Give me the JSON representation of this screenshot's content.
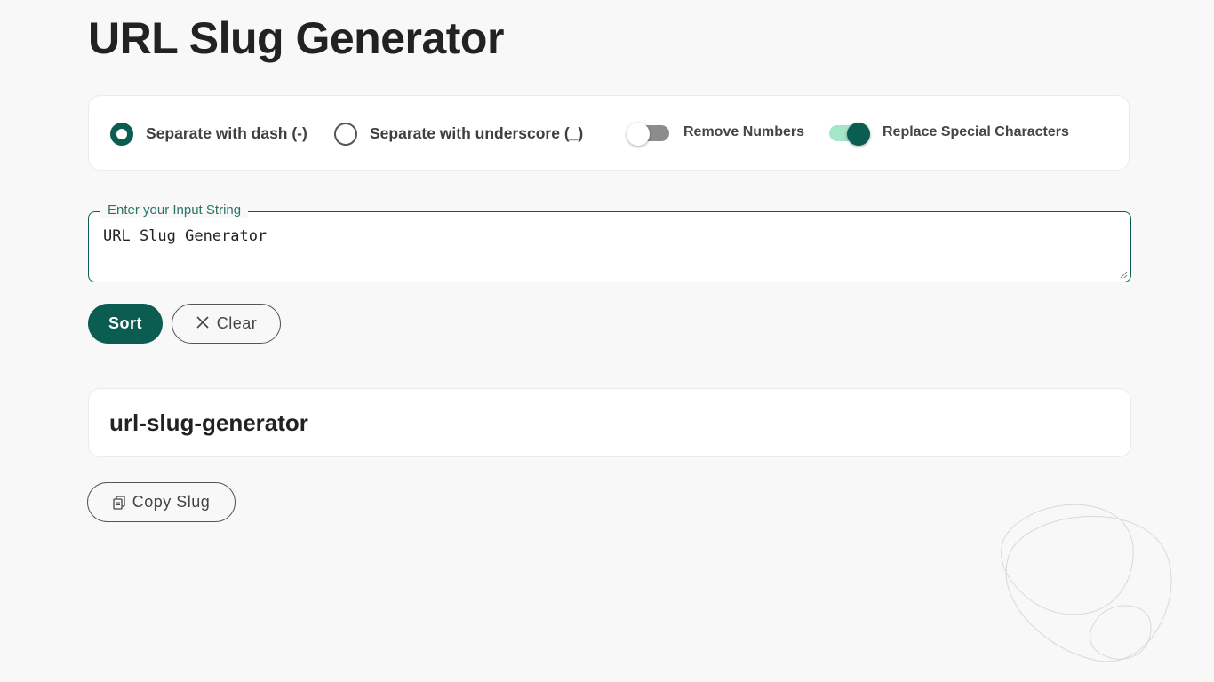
{
  "page": {
    "title": "URL Slug Generator"
  },
  "options": {
    "separator_dash_label": "Separate with dash (-)",
    "separator_underscore_label": "Separate with underscore (_)",
    "selected_separator": "dash",
    "remove_numbers_label": "Remove Numbers",
    "remove_numbers_enabled": false,
    "replace_special_label": "Replace Special Characters",
    "replace_special_enabled": true
  },
  "input": {
    "legend": "Enter your Input String",
    "value": "URL Slug Generator"
  },
  "actions": {
    "sort_label": "Sort",
    "clear_label": "Clear",
    "clear_icon": "close-icon",
    "copy_label": "Copy Slug",
    "copy_icon": "copy-icon"
  },
  "result": {
    "slug": "url-slug-generator"
  },
  "colors": {
    "accent": "#0b5d51",
    "switch_track_on": "#a5e6c8",
    "switch_track_off": "#8c8c8c",
    "background": "#f8f8f9"
  }
}
